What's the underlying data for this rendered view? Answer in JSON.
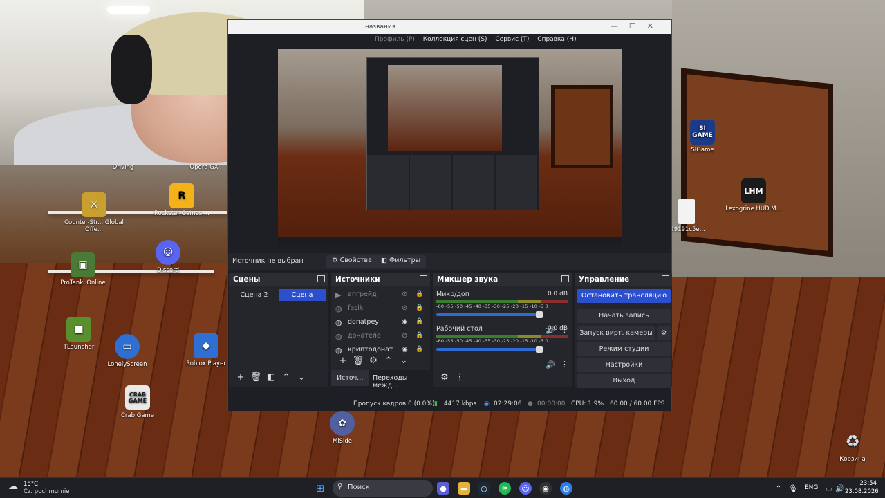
{
  "desktop": {
    "icons": [
      {
        "label": "Driving",
        "color": "#444"
      },
      {
        "label": "Opera GX",
        "color": "#c0203a"
      },
      {
        "label": "Counter-Str... Global Offe...",
        "color": "#c9a030"
      },
      {
        "label": "Rockstar Games ...",
        "color": "#f3b11a"
      },
      {
        "label": "ProTanki Online",
        "color": "#4a7a35"
      },
      {
        "label": "Discord",
        "color": "#5865f2"
      },
      {
        "label": "TLauncher",
        "color": "#5a8f2e"
      },
      {
        "label": "LonelyScreen",
        "color": "#2f6fd1"
      },
      {
        "label": "Roblox Player",
        "color": "#2f6fd1"
      },
      {
        "label": "Crab Game",
        "color": "#e9e9e9"
      },
      {
        "label": "MiSide",
        "color": "#5060a0"
      },
      {
        "label": "SIGame",
        "color": "#1a3a8a"
      },
      {
        "label": "Lexogrine HUD M...",
        "color": "#1b1b1b"
      },
      {
        "label": "-99191c5e...",
        "color": "#f3f3f3"
      },
      {
        "label": "Корзина",
        "color": "#cfe3f5"
      }
    ],
    "icon_glyphs": {
      "rockstar": "R",
      "sigame": "SI GAME",
      "lhm": "LHM",
      "crab": "CRAB GAME"
    }
  },
  "obs": {
    "title": "названия",
    "menu": [
      {
        "label": "Профиль (P)",
        "dim": true
      },
      {
        "label": "Коллекция сцен (S)"
      },
      {
        "label": "Сервис (T)"
      },
      {
        "label": "Справка (H)"
      }
    ],
    "no_source": "Источник не выбран",
    "properties_btn": "Свойства",
    "filters_btn": "Фильтры",
    "scenes": {
      "title": "Сцены",
      "items": [
        "Сцена 2",
        "Сцена"
      ],
      "active": 1
    },
    "sources": {
      "title": "Источники",
      "items": [
        {
          "label": "апгрейд",
          "hidden": true,
          "icon": "play"
        },
        {
          "label": "fasik",
          "hidden": true,
          "icon": "globe"
        },
        {
          "label": "donatpey",
          "hidden": false,
          "icon": "globe"
        },
        {
          "label": "донатело",
          "hidden": true,
          "icon": "globe"
        },
        {
          "label": "криптодонат",
          "hidden": false,
          "icon": "globe"
        }
      ]
    },
    "mixer": {
      "title": "Микшер звука",
      "channels": [
        {
          "label": "Микр/доп",
          "db": "0.0 dB"
        },
        {
          "label": "Рабочий стол",
          "db": "-0.0 dB"
        }
      ],
      "ticks": "-60 -55 -50 -45 -40 -35 -30 -25 -20 -15 -10 -5 0"
    },
    "controls": {
      "title": "Управление",
      "buttons": [
        "Остановить трансляцию",
        "Начать запись",
        "Запуск вирт. камеры",
        "Режим студии",
        "Настройки",
        "Выход"
      ]
    },
    "tabs": [
      "Источ...",
      "Переходы межд..."
    ],
    "status": {
      "dropped": "Пропуск кадров 0 (0.0%)",
      "bitrate": "4417 kbps",
      "live": "02:29:06",
      "rec": "00:00:00",
      "cpu": "CPU: 1.9%",
      "fps": "60.00 / 60.00 FPS"
    }
  },
  "taskbar": {
    "weather_temp": "15°C",
    "weather_desc": "Cz. pochmurnie",
    "search": "Поиск",
    "lang": "ENG",
    "time": "23:54",
    "date": "23.08.2026"
  },
  "colors": {
    "accent": "#2c4fce",
    "obs_bg": "#1e1f24",
    "dock_bg": "#25262c"
  }
}
